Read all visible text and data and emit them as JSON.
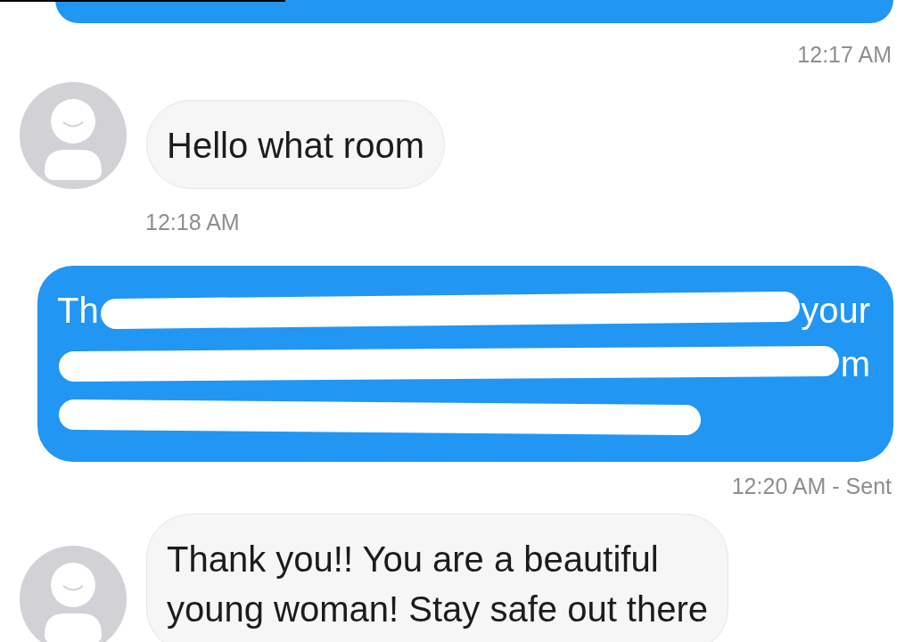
{
  "messages": [
    {
      "kind": "outgoing_cut"
    },
    {
      "kind": "timestamp_right",
      "text": "12:17 AM"
    },
    {
      "kind": "incoming",
      "lines": [
        "Hello what room"
      ]
    },
    {
      "kind": "timestamp_left",
      "text": "12:18 AM"
    },
    {
      "kind": "outgoing_redacted",
      "lines": [
        [
          {
            "kind": "text",
            "text": "Th"
          },
          {
            "kind": "redaction"
          },
          {
            "kind": "text",
            "text": "your"
          }
        ],
        [
          {
            "kind": "redaction"
          },
          {
            "kind": "text",
            "text": "m"
          }
        ],
        [
          {
            "kind": "redaction"
          }
        ]
      ]
    },
    {
      "kind": "timestamp_right",
      "text": "12:20 AM - Sent"
    },
    {
      "kind": "incoming",
      "lines": [
        "Thank you!! You are a beautiful",
        "young woman! Stay safe out there"
      ]
    }
  ]
}
